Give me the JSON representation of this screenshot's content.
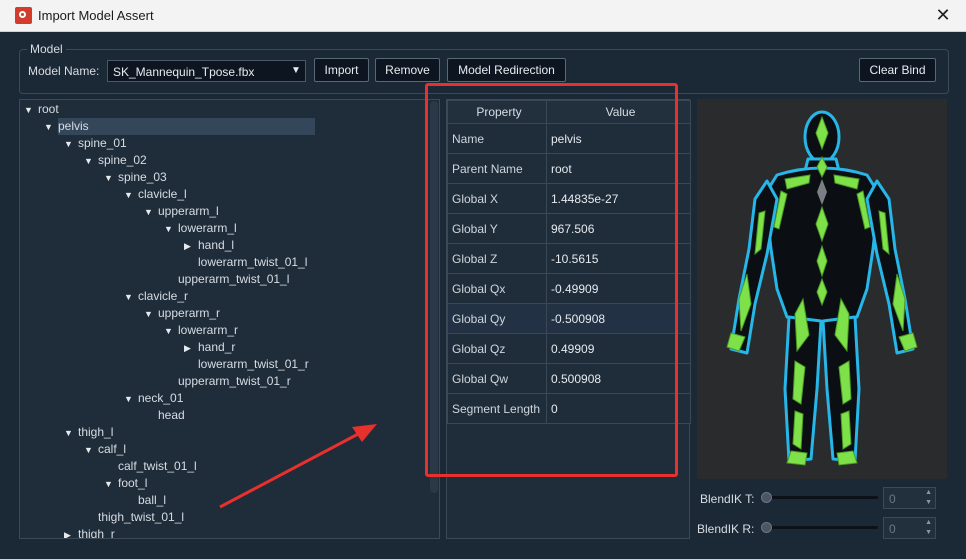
{
  "window": {
    "title": "Import Model Assert",
    "close_glyph": "✕"
  },
  "model": {
    "group_title": "Model",
    "name_label": "Model Name:",
    "selected_model": "SK_Mannequin_Tpose.fbx",
    "import_label": "Import",
    "remove_label": "Remove",
    "redirect_label": "Model Redirection",
    "clear_label": "Clear Bind"
  },
  "tree": [
    {
      "label": "root",
      "expanded": true
    },
    {
      "label": "pelvis",
      "expanded": true,
      "selected": true
    },
    {
      "label": "spine_01",
      "expanded": true
    },
    {
      "label": "spine_02",
      "expanded": true
    },
    {
      "label": "spine_03",
      "expanded": true
    },
    {
      "label": "clavicle_l",
      "expanded": true
    },
    {
      "label": "upperarm_l",
      "expanded": true
    },
    {
      "label": "lowerarm_l",
      "expanded": true
    },
    {
      "label": "hand_l",
      "expanded": false
    },
    {
      "label": "lowerarm_twist_01_l"
    },
    {
      "label": "upperarm_twist_01_l"
    },
    {
      "label": "clavicle_r",
      "expanded": true
    },
    {
      "label": "upperarm_r",
      "expanded": true
    },
    {
      "label": "lowerarm_r",
      "expanded": true
    },
    {
      "label": "hand_r",
      "expanded": false
    },
    {
      "label": "lowerarm_twist_01_r"
    },
    {
      "label": "upperarm_twist_01_r"
    },
    {
      "label": "neck_01",
      "expanded": true
    },
    {
      "label": "head"
    },
    {
      "label": "thigh_l",
      "expanded": true
    },
    {
      "label": "calf_l",
      "expanded": true
    },
    {
      "label": "calf_twist_01_l"
    },
    {
      "label": "foot_l",
      "expanded": true
    },
    {
      "label": "ball_l"
    },
    {
      "label": "thigh_twist_01_l"
    },
    {
      "label": "thigh_r",
      "expanded": false
    }
  ],
  "properties": {
    "header_property": "Property",
    "header_value": "Value",
    "rows": [
      {
        "key": "Name",
        "value": "pelvis"
      },
      {
        "key": "Parent Name",
        "value": "root"
      },
      {
        "key": "Global X",
        "value": "1.44835e-27"
      },
      {
        "key": "Global Y",
        "value": "967.506"
      },
      {
        "key": "Global Z",
        "value": "-10.5615"
      },
      {
        "key": "Global Qx",
        "value": "-0.49909"
      },
      {
        "key": "Global Qy",
        "value": "-0.500908"
      },
      {
        "key": "Global Qz",
        "value": "0.49909"
      },
      {
        "key": "Global Qw",
        "value": "0.500908"
      },
      {
        "key": "Segment Length",
        "value": "0"
      }
    ]
  },
  "blend": {
    "t_label": "BlendIK T:",
    "t_value": "0",
    "r_label": "BlendIK R:",
    "r_value": "0"
  },
  "colors": {
    "bone_green": "#7fe14a",
    "outline_cyan": "#27b6e8",
    "annotation_red": "#e8302c"
  }
}
